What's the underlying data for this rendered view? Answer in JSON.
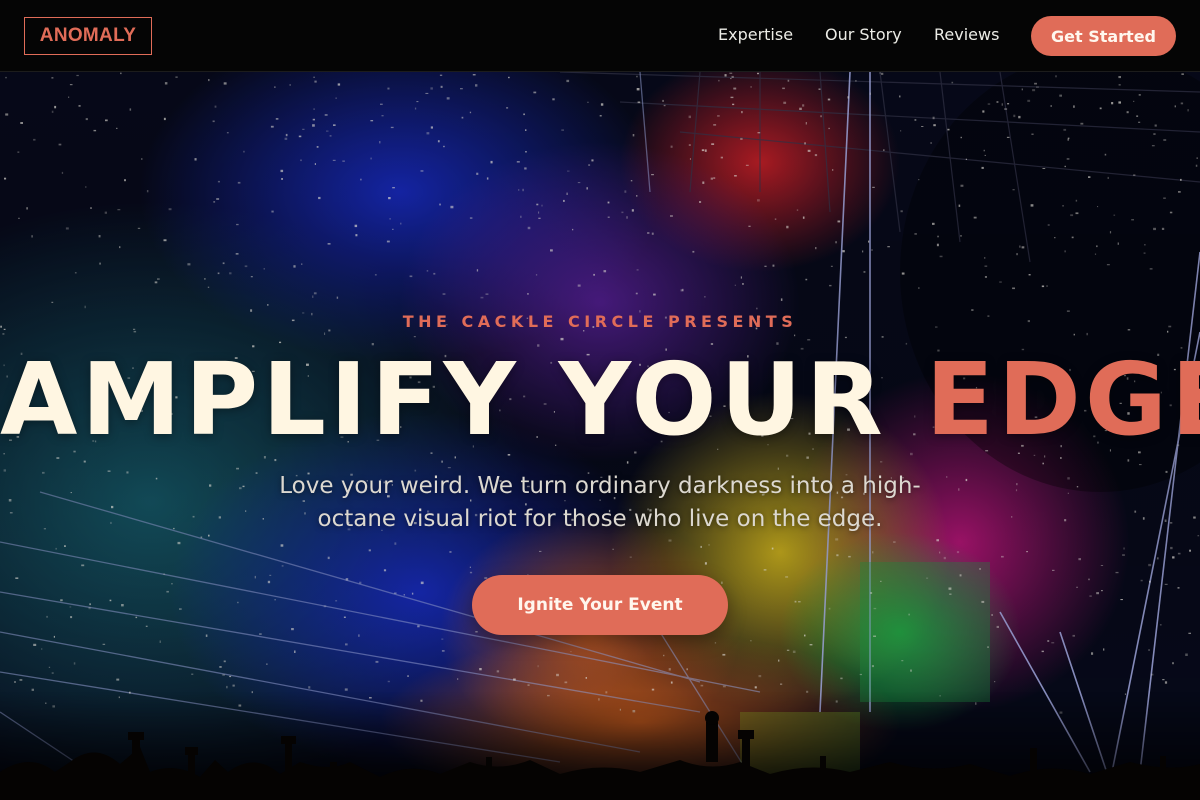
{
  "nav": {
    "logo": "ANOMALY",
    "links": [
      "Expertise",
      "Our Story",
      "Reviews"
    ],
    "cta_label": "Get Started"
  },
  "hero": {
    "eyebrow": "THE CACKLE CIRCLE PRESENTS",
    "headline_main": "AMPLIFY YOUR",
    "headline_accent": "EDGE",
    "subtitle": "Love your weird. We turn ordinary darkness into a high-octane visual riot for those who live on the edge.",
    "cta_label": "Ignite Your Event",
    "background_image": "concert-crowd-with-confetti-and-lasers"
  },
  "colors": {
    "accent": "#e06c58",
    "headline": "#fff6e2",
    "nav_background": "#050505",
    "text_light": "#ecece6"
  }
}
